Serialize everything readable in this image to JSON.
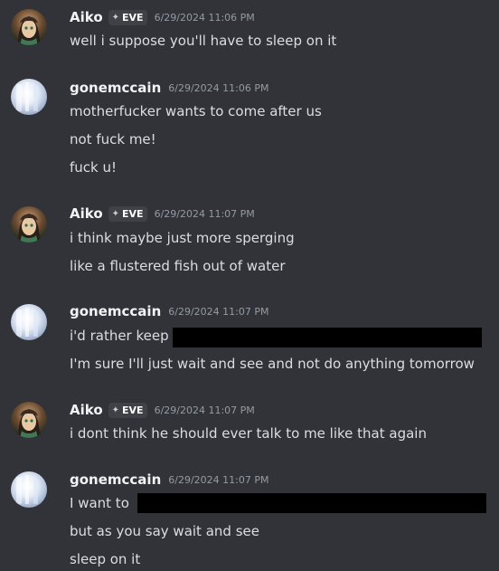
{
  "colors": {
    "background": "#313338",
    "username": "#f2f3f5",
    "text": "#dbdee1",
    "timestamp": "#949ba4",
    "redaction": "#000000"
  },
  "messages": [
    {
      "author": "Aiko",
      "tag": "EVE",
      "tag_icon": "diamond-sparkle-icon",
      "timestamp": "6/29/2024 11:06 PM",
      "lines": [
        "well i suppose you'll have to sleep on it"
      ]
    },
    {
      "author": "gonemccain",
      "timestamp": "6/29/2024 11:06 PM",
      "lines": [
        "motherfucker wants to come after us",
        "not fuck me!",
        "fuck u!"
      ]
    },
    {
      "author": "Aiko",
      "tag": "EVE",
      "tag_icon": "diamond-sparkle-icon",
      "timestamp": "6/29/2024 11:07 PM",
      "lines": [
        "i think maybe just more sperging",
        "like a flustered fish out of water"
      ]
    },
    {
      "author": "gonemccain",
      "timestamp": "6/29/2024 11:07 PM",
      "lines": [
        "i'd rather keep",
        "I'm sure I'll just wait and see and not do anything tomorrow"
      ]
    },
    {
      "author": "Aiko",
      "tag": "EVE",
      "tag_icon": "diamond-sparkle-icon",
      "timestamp": "6/29/2024 11:07 PM",
      "lines": [
        "i dont think he should ever talk to me like that again"
      ]
    },
    {
      "author": "gonemccain",
      "timestamp": "6/29/2024 11:07 PM",
      "lines": [
        "I want to",
        "but as you say wait and see",
        "sleep on it"
      ]
    }
  ]
}
